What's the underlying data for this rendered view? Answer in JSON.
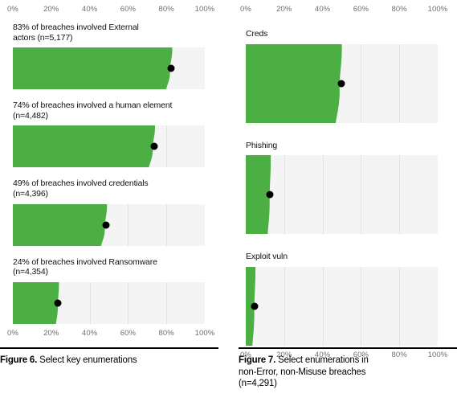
{
  "axis": {
    "ticks": [
      "0%",
      "20%",
      "40%",
      "60%",
      "80%",
      "100%"
    ],
    "tick_values": [
      0,
      20,
      40,
      60,
      80,
      100
    ],
    "min": 0,
    "max": 100
  },
  "colors": {
    "bar_fill": "#4CAF43",
    "track": "#F4F4F4",
    "gridline": "#E3E3E3",
    "marker": "#000000",
    "tick_text": "#6F6F6F",
    "label_text": "#111111"
  },
  "figure6": {
    "caption_label": "Figure 6.",
    "caption_text": " Select key enumerations",
    "bars": [
      {
        "label": "83% of breaches involved External\nactors (n=5,177)",
        "value": 83,
        "n": "5,177"
      },
      {
        "label": "74% of breaches involved a human element\n (n=4,482)",
        "value": 74,
        "n": "4,482"
      },
      {
        "label": "49% of breaches involved credentials\n (n=4,396)",
        "value": 49,
        "n": "4,396"
      },
      {
        "label": "24% of breaches involved Ransomware\n (n=4,354)",
        "value": 24,
        "n": "4,354"
      }
    ]
  },
  "figure7": {
    "caption_label": "Figure 7.",
    "caption_text": " Select enumerations in\nnon-Error, non-Misuse breaches\n(n=4,291)",
    "bars": [
      {
        "label": "Creds",
        "value": 50
      },
      {
        "label": "Phishing",
        "value": 13
      },
      {
        "label": "Exploit vuln",
        "value": 5
      }
    ]
  },
  "chart_data": [
    {
      "type": "bar",
      "title": "Figure 6. Select key enumerations",
      "orientation": "horizontal",
      "categories": [
        "83% of breaches involved External actors (n=5,177)",
        "74% of breaches involved a human element (n=4,482)",
        "49% of breaches involved credentials (n=4,396)",
        "24% of breaches involved Ransomware (n=4,354)"
      ],
      "values": [
        83,
        74,
        49,
        24
      ],
      "xlabel": "",
      "ylabel": "",
      "xlim": [
        0,
        100
      ],
      "xticks": [
        0,
        20,
        40,
        60,
        80,
        100
      ],
      "xticklabels": [
        "0%",
        "20%",
        "40%",
        "60%",
        "80%",
        "100%"
      ],
      "grid": true,
      "legend": "none",
      "notes": "Each bar has a black point marker at its value; bar right edge drawn with a slight wavy taper."
    },
    {
      "type": "bar",
      "title": "Figure 7. Select enumerations in non-Error, non-Misuse breaches (n=4,291)",
      "orientation": "horizontal",
      "categories": [
        "Creds",
        "Phishing",
        "Exploit vuln"
      ],
      "values": [
        50,
        13,
        5
      ],
      "xlabel": "",
      "ylabel": "",
      "xlim": [
        0,
        100
      ],
      "xticks": [
        0,
        20,
        40,
        60,
        80,
        100
      ],
      "xticklabels": [
        "0%",
        "20%",
        "40%",
        "60%",
        "80%",
        "100%"
      ],
      "grid": true,
      "legend": "none",
      "notes": "Each bar has a black point marker at its value; bar right edge drawn with a slight wavy taper."
    }
  ]
}
